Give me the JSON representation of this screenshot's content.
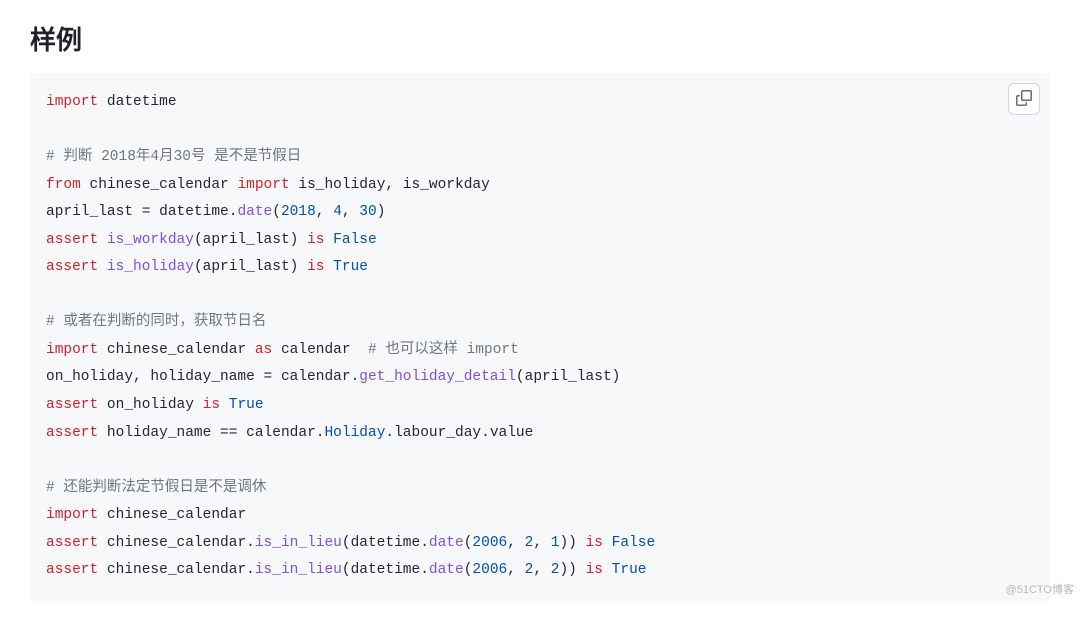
{
  "heading": "样例",
  "copy_button_title": "Copy",
  "watermark": "@51CTO博客",
  "code": {
    "l1": {
      "kw_import": "import",
      "mod": "datetime"
    },
    "l3": {
      "cmt": "# 判断 2018年4月30号 是不是节假日"
    },
    "l4": {
      "kw_from": "from",
      "mod": "chinese_calendar",
      "kw_import": "import",
      "n1": "is_holiday",
      "comma": ", ",
      "n2": "is_workday"
    },
    "l5": {
      "var": "april_last",
      "eq": " = ",
      "mod": "datetime",
      "dot": ".",
      "fn": "date",
      "open": "(",
      "a1": "2018",
      "c1": ", ",
      "a2": "4",
      "c2": ", ",
      "a3": "30",
      "close": ")"
    },
    "l6": {
      "kw_assert": "assert",
      "fn": "is_workday",
      "open": "(",
      "arg": "april_last",
      "close": ") ",
      "kw_is": "is",
      "val": "False"
    },
    "l7": {
      "kw_assert": "assert",
      "fn": "is_holiday",
      "open": "(",
      "arg": "april_last",
      "close": ") ",
      "kw_is": "is",
      "val": "True"
    },
    "l9": {
      "cmt": "# 或者在判断的同时，获取节日名"
    },
    "l10": {
      "kw_import": "import",
      "mod": "chinese_calendar",
      "kw_as": "as",
      "alias": "calendar",
      "sp": "  ",
      "cmt": "# 也可以这样 import"
    },
    "l11": {
      "v1": "on_holiday",
      "c1": ", ",
      "v2": "holiday_name",
      "eq": " = ",
      "obj": "calendar",
      "dot": ".",
      "fn": "get_holiday_detail",
      "open": "(",
      "arg": "april_last",
      "close": ")"
    },
    "l12": {
      "kw_assert": "assert",
      "var": "on_holiday ",
      "kw_is": "is",
      "val": "True"
    },
    "l13": {
      "kw_assert": "assert",
      "var": "holiday_name ",
      "op": "== ",
      "obj": "calendar",
      "d1": ".",
      "cls": "Holiday",
      "d2": ".",
      "attr": "labour_day",
      "d3": ".",
      "prop": "value"
    },
    "l15": {
      "cmt": "# 还能判断法定节假日是不是调休"
    },
    "l16": {
      "kw_import": "import",
      "mod": "chinese_calendar"
    },
    "l17": {
      "kw_assert": "assert",
      "obj": "chinese_calendar",
      "d1": ".",
      "fn": "is_in_lieu",
      "open": "(",
      "m": "datetime",
      "d2": ".",
      "fn2": "date",
      "o2": "(",
      "a1": "2006",
      "c1": ", ",
      "a2": "2",
      "c2": ", ",
      "a3": "1",
      "cl2": ")",
      "close": ") ",
      "kw_is": "is",
      "val": "False"
    },
    "l18": {
      "kw_assert": "assert",
      "obj": "chinese_calendar",
      "d1": ".",
      "fn": "is_in_lieu",
      "open": "(",
      "m": "datetime",
      "d2": ".",
      "fn2": "date",
      "o2": "(",
      "a1": "2006",
      "c1": ", ",
      "a2": "2",
      "c2": ", ",
      "a3": "2",
      "cl2": ")",
      "close": ") ",
      "kw_is": "is",
      "val": "True"
    }
  }
}
